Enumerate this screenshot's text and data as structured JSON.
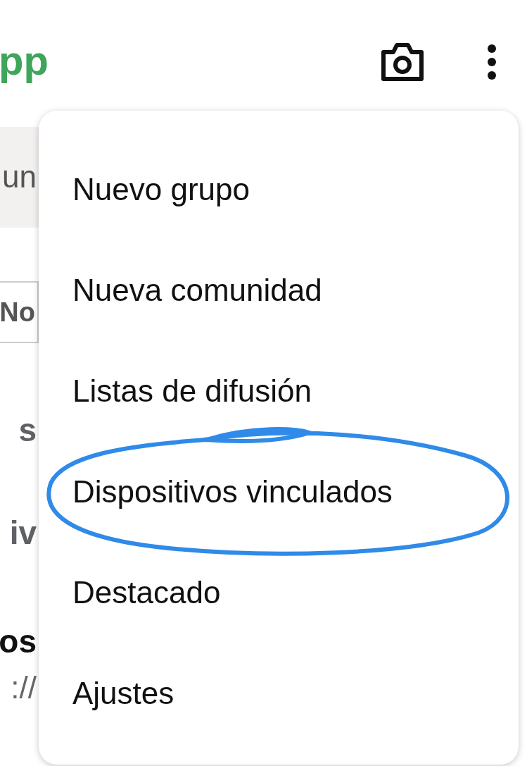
{
  "header": {
    "app_title": "pp"
  },
  "background": {
    "search_text": "un",
    "filter_chip": "No",
    "lines": [
      {
        "text": "s",
        "kind": "label"
      },
      {
        "text": "iv",
        "kind": "label"
      },
      {
        "text": "os",
        "kind": "name"
      },
      {
        "text": "://",
        "kind": "link"
      }
    ]
  },
  "menu": {
    "items": [
      {
        "label": "Nuevo grupo",
        "circled": false
      },
      {
        "label": "Nueva comunidad",
        "circled": false
      },
      {
        "label": "Listas de difusión",
        "circled": false
      },
      {
        "label": "Dispositivos vinculados",
        "circled": true
      },
      {
        "label": "Destacado",
        "circled": false
      },
      {
        "label": "Ajustes",
        "circled": false
      }
    ]
  }
}
